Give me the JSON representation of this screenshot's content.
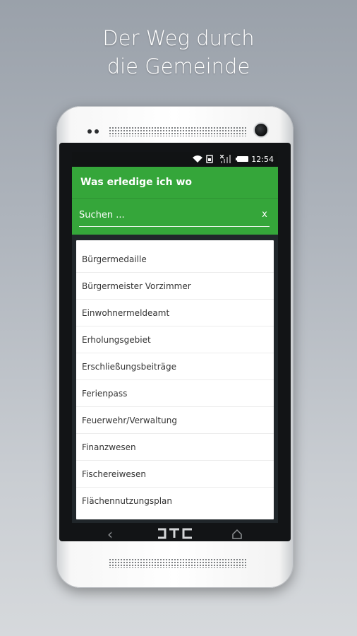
{
  "promo": {
    "line1": "Der Weg durch",
    "line2": "die Gemeinde"
  },
  "statusbar": {
    "time": "12:54",
    "icons": [
      "wifi-icon",
      "sim-icon",
      "signal-icon",
      "battery-icon"
    ]
  },
  "app": {
    "title": "Was erledige ich wo",
    "search": {
      "placeholder": "Suchen ...",
      "clear_label": "x"
    },
    "items": [
      "Bürgermedaille",
      "Bürgermeister Vorzimmer",
      "Einwohnermeldeamt",
      "Erholungsgebiet",
      "Erschließungsbeiträge",
      "Ferienpass",
      "Feuerwehr/Verwaltung",
      "Finanzwesen",
      "Fischereiwesen",
      "Flächennutzungsplan"
    ]
  },
  "device": {
    "brand": "HTC",
    "nav_icons": [
      "back-icon",
      "home-icon"
    ]
  },
  "colors": {
    "accent": "#35a63a",
    "background": "#aeb4bc"
  }
}
